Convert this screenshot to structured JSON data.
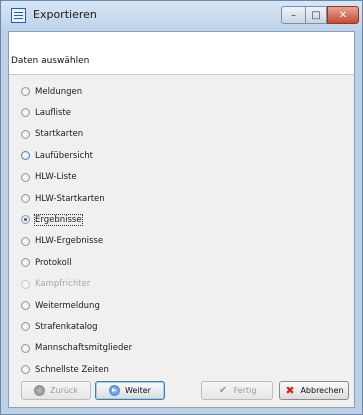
{
  "window": {
    "title": "Exportieren",
    "min_glyph": "–",
    "max_glyph": "□",
    "close_glyph": "✕"
  },
  "header": {
    "text": "Daten auswählen"
  },
  "options": [
    {
      "label": "Meldungen",
      "checked": false,
      "disabled": false
    },
    {
      "label": "Laufliste",
      "checked": false,
      "disabled": false
    },
    {
      "label": "Startkarten",
      "checked": false,
      "disabled": false
    },
    {
      "label": "Laufübersicht",
      "checked": false,
      "disabled": false,
      "hover": true
    },
    {
      "label": "HLW-Liste",
      "checked": false,
      "disabled": false
    },
    {
      "label": "HLW-Startkarten",
      "checked": false,
      "disabled": false
    },
    {
      "label": "Ergebnisse",
      "checked": true,
      "disabled": false,
      "focused": true
    },
    {
      "label": "HLW-Ergebnisse",
      "checked": false,
      "disabled": false
    },
    {
      "label": "Protokoll",
      "checked": false,
      "disabled": false
    },
    {
      "label": "Kampfrichter",
      "checked": false,
      "disabled": true
    },
    {
      "label": "Weitermeldung",
      "checked": false,
      "disabled": false
    },
    {
      "label": "Strafenkatalog",
      "checked": false,
      "disabled": false
    },
    {
      "label": "Mannschaftsmitglieder",
      "checked": false,
      "disabled": false
    },
    {
      "label": "Schnellste Zeiten",
      "checked": false,
      "disabled": false
    }
  ],
  "buttons": {
    "back": {
      "label": "Zurück",
      "disabled": true,
      "icon": "back-circle-icon"
    },
    "next": {
      "label": "Weiter",
      "disabled": false,
      "icon": "arrow-right-circle-icon"
    },
    "finish": {
      "label": "Fertig",
      "disabled": true,
      "icon": "checkmark-icon",
      "glyph": "✔"
    },
    "cancel": {
      "label": "Abbrechen",
      "disabled": false,
      "icon": "cancel-x-icon",
      "glyph": "✖"
    }
  },
  "colors": {
    "frame": "#bcd0e6",
    "client_bg": "#f0f0f0",
    "header_bg": "#ffffff",
    "close_red": "#c74a32",
    "cancel_red": "#d2281b",
    "radio_selected": "#1f5fae"
  }
}
